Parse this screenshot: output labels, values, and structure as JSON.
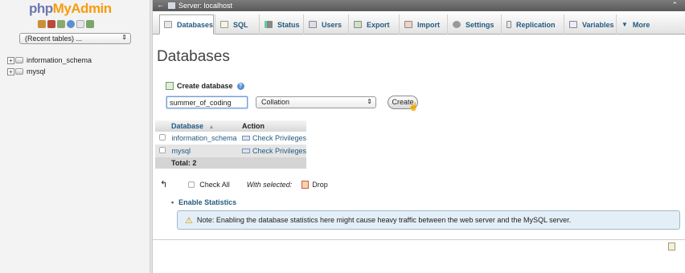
{
  "nav": {
    "logo_php": "php",
    "logo_my": "My",
    "logo_admin": "Admin",
    "quick_icons": [
      "home-icon",
      "exit-icon",
      "sql-query-icon",
      "info-icon",
      "docs-icon",
      "settings-icon"
    ],
    "recent_tables": "(Recent tables) ...",
    "databases": [
      {
        "name": "information_schema"
      },
      {
        "name": "mysql"
      }
    ]
  },
  "topbar": {
    "back": "←",
    "server": "Server: localhost",
    "collapse": "⌃"
  },
  "tabs": [
    {
      "label": "Databases",
      "icon": "databases-icon",
      "active": true
    },
    {
      "label": "SQL",
      "icon": "sql-icon"
    },
    {
      "label": "Status",
      "icon": "status-icon"
    },
    {
      "label": "Users",
      "icon": "users-icon"
    },
    {
      "label": "Export",
      "icon": "export-icon"
    },
    {
      "label": "Import",
      "icon": "import-icon"
    },
    {
      "label": "Settings",
      "icon": "settings-icon"
    },
    {
      "label": "Replication",
      "icon": "replication-icon"
    },
    {
      "label": "Variables",
      "icon": "variables-icon"
    },
    {
      "label": "More",
      "icon": "more-icon"
    }
  ],
  "page_title": "Databases",
  "create": {
    "label": "Create database",
    "db_name_value": "summer_of_coding",
    "collation": "Collation",
    "button": "Create"
  },
  "table": {
    "header_database": "Database",
    "header_sort": "▲",
    "header_action": "Action",
    "rows": [
      {
        "name": "information_schema",
        "action": "Check Privileges"
      },
      {
        "name": "mysql",
        "action": "Check Privileges"
      }
    ],
    "total": "Total: 2"
  },
  "bulk": {
    "arrow": "↰",
    "check_all": "Check All",
    "with_selected": "With selected:",
    "drop": "Drop"
  },
  "enable_statistics": "Enable Statistics",
  "notice": {
    "icon": "⚠",
    "text": "Note: Enabling the database statistics here might cause heavy traffic between the web server and the MySQL server."
  },
  "colors": {
    "link": "#235a81",
    "logo_php": "#6c78af",
    "logo_myadmin": "#f89c0e",
    "notice_bg": "#e4eef6"
  }
}
